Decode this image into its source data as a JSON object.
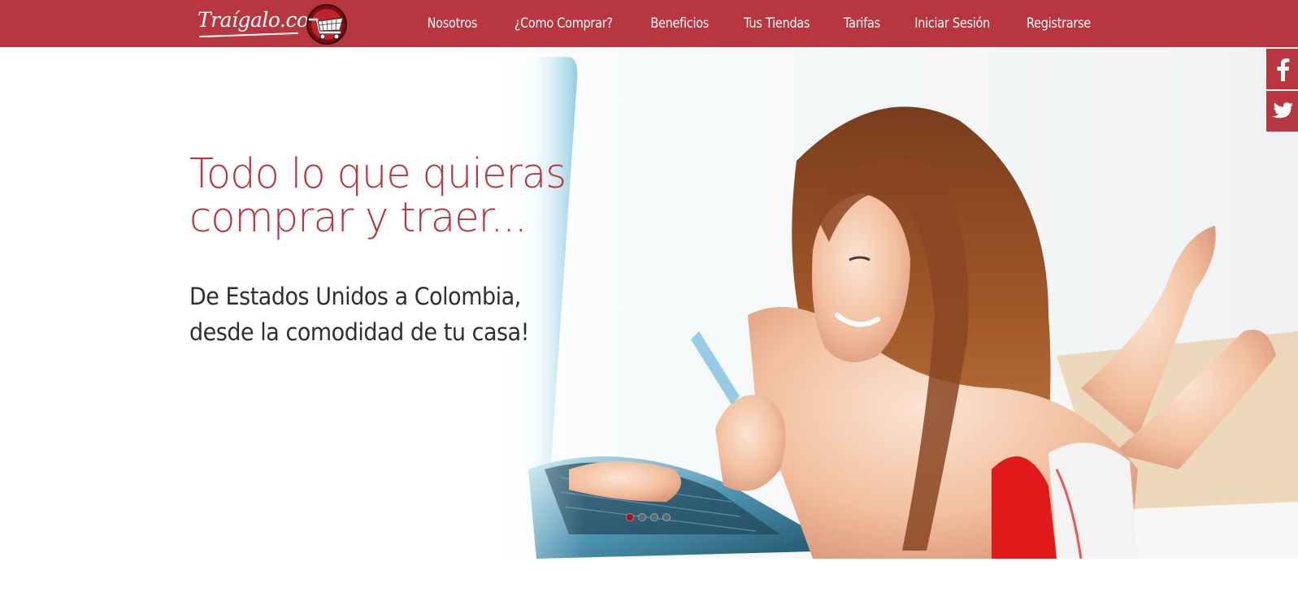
{
  "brand": {
    "logo_text": "Traígalo.com"
  },
  "nav": {
    "items": [
      {
        "label": "Nosotros"
      },
      {
        "label": "¿Como Comprar?"
      },
      {
        "label": "Beneficios"
      },
      {
        "label": "Tus Tiendas"
      },
      {
        "label": "Tarifas"
      },
      {
        "label": "Iniciar Sesión"
      },
      {
        "label": "Registrarse"
      }
    ]
  },
  "hero": {
    "title_line1": "Todo lo que quieras",
    "title_line2": "comprar y traer...",
    "subtitle_line1": "De Estados Unidos a Colombia,",
    "subtitle_line2": "desde la comodidad de tu casa!",
    "slides_total": 4,
    "active_slide": 1
  },
  "social": {
    "items": [
      {
        "icon": "facebook-icon"
      },
      {
        "icon": "twitter-icon"
      }
    ]
  },
  "colors": {
    "brand_red": "#b8363f",
    "text_dark": "#2f2f2f",
    "dot_active": "#a0141c",
    "dot_inactive": "#5a6872"
  }
}
